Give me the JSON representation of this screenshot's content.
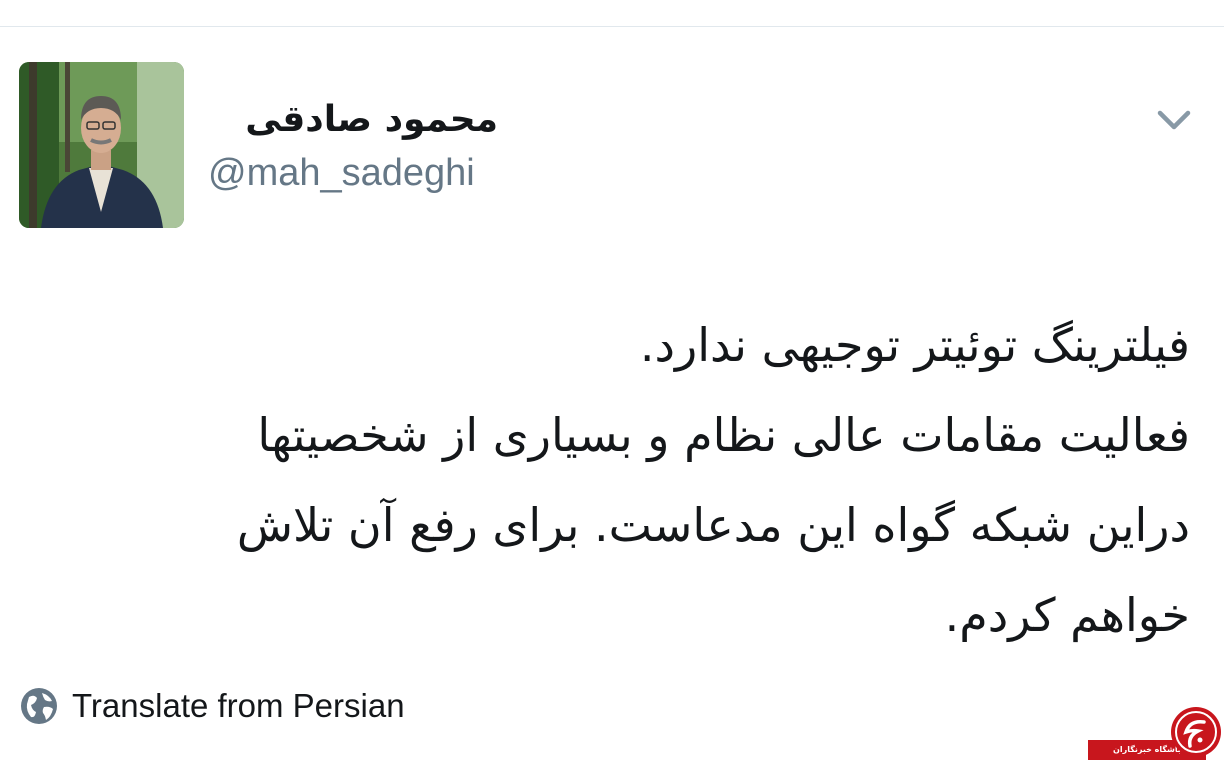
{
  "tweet": {
    "author": {
      "display_name": "محمود صادقی",
      "handle": "@mah_sadeghi",
      "avatar_icon": "profile-photo"
    },
    "menu_icon": "chevron-down-icon",
    "text_lines": [
      "فیلترینگ توئیتر توجیهی ندارد.",
      "فعالیت مقامات عالی نظام و بسیاری از شخصیتها",
      "دراین شبکه گواه این مدعاست. برای رفع آن تلاش",
      "خواهم کردم."
    ],
    "translate": {
      "icon": "globe-icon",
      "label": "Translate from Persian"
    }
  },
  "watermark": {
    "text": "باشگاه خبرنگاران",
    "logo_text": "جوان",
    "color": "#c8161d"
  },
  "colors": {
    "text": "#14171a",
    "secondary": "#657786",
    "chevron": "#8899a6",
    "divider": "#e1e8ed"
  }
}
